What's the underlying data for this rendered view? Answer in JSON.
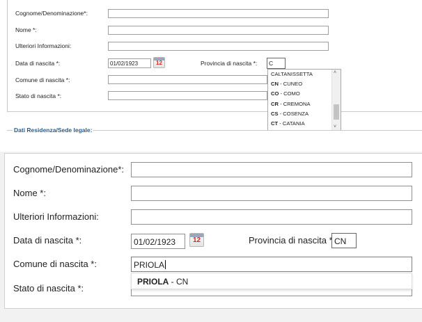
{
  "top": {
    "fields": {
      "cognome_label": "Cognome/Denominazione*:",
      "nome_label": "Nome *:",
      "ulteriori_label": "Ulteriori Informazioni:",
      "data_label": "Data di nascita *:",
      "data_value": "01/02/1923",
      "calendar_day": "12",
      "provincia_label": "Provincia di nascita *:",
      "provincia_value": "C",
      "comune_label": "Comune di nascita *:",
      "stato_label": "Stato di nascita *:"
    },
    "dropdown": [
      {
        "code": "",
        "name": "CALTANISSETTA"
      },
      {
        "code": "CN",
        "name": " - CUNEO"
      },
      {
        "code": "CO",
        "name": " - COMO"
      },
      {
        "code": "CR",
        "name": " - CREMONA"
      },
      {
        "code": "CS",
        "name": " - COSENZA"
      },
      {
        "code": "CT",
        "name": " - CATANIA"
      }
    ],
    "scroll_up": "˄",
    "scroll_down": "˅",
    "section_legend": "Dati Residenza/Sede legale:"
  },
  "bottom": {
    "fields": {
      "cognome_label": "Cognome/Denominazione*:",
      "nome_label": "Nome *:",
      "ulteriori_label": "Ulteriori Informazioni:",
      "data_label": "Data di nascita *:",
      "data_value": "01/02/1923",
      "calendar_day": "12",
      "provincia_label": "Provincia di nascita *:",
      "provincia_value": "CN",
      "comune_label": "Comune di nascita *:",
      "comune_value": "PRIOLA",
      "stato_label": "Stato di nascita *:"
    },
    "autocomplete": {
      "name": "PRIOLA",
      "suffix": " - CN"
    }
  }
}
